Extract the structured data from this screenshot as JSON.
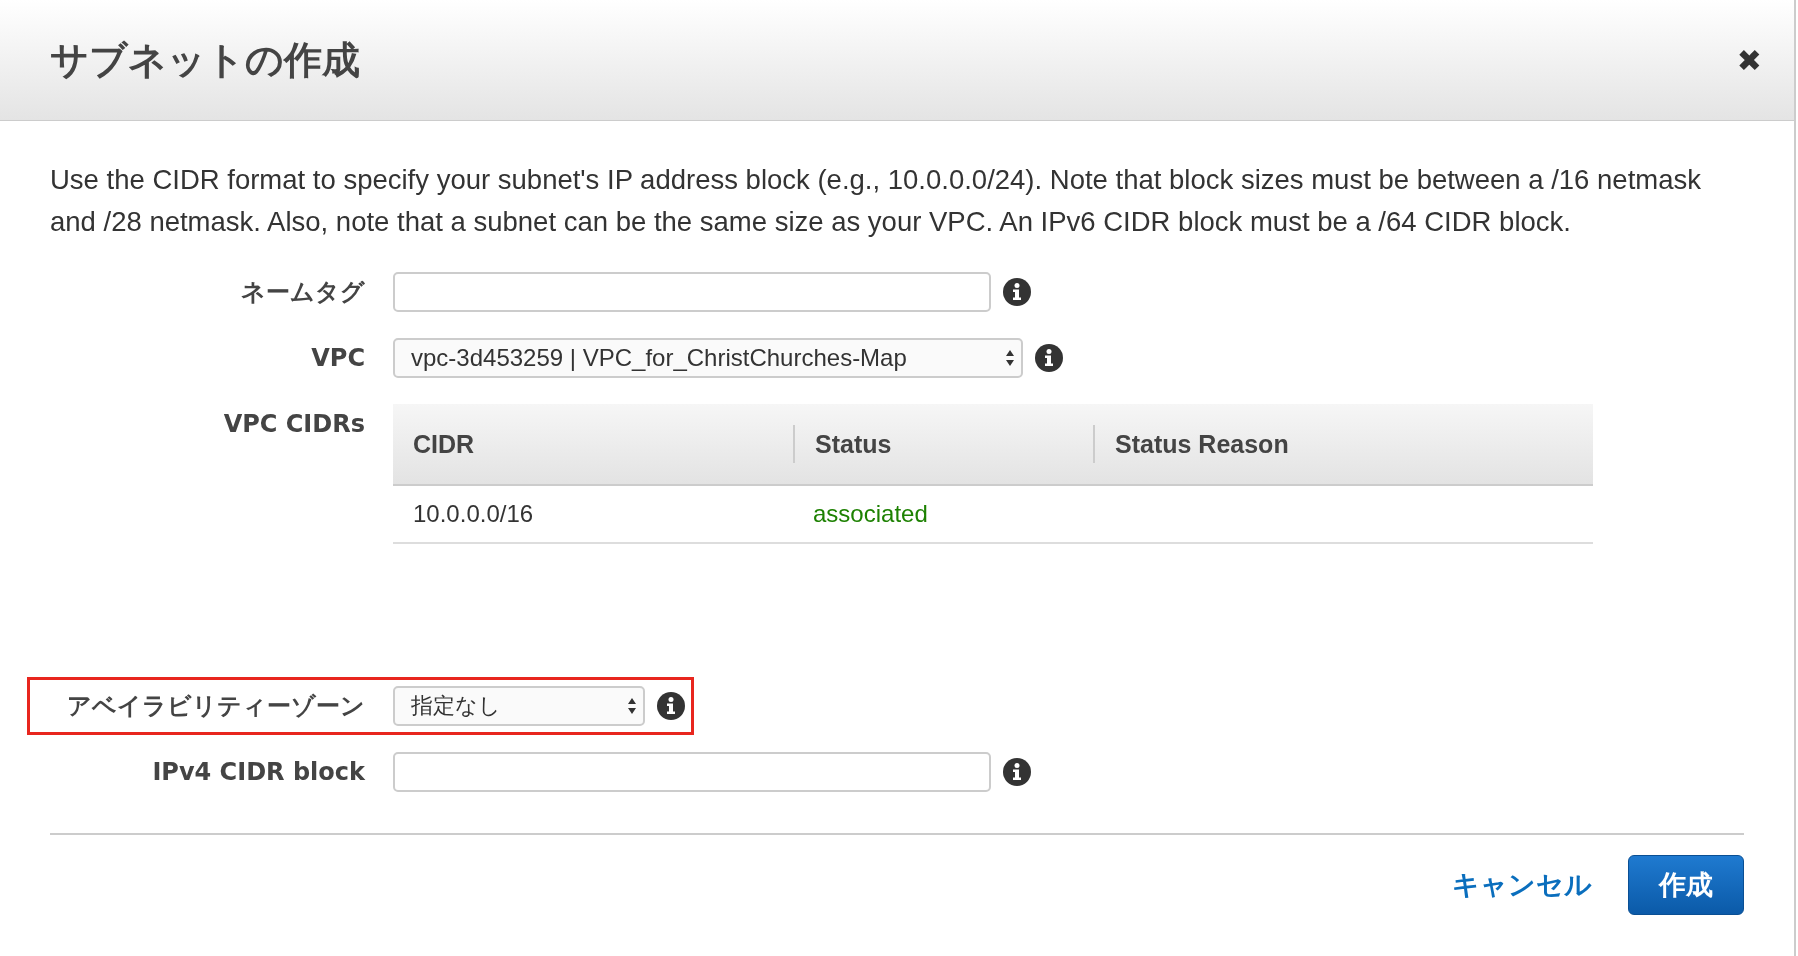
{
  "dialog": {
    "title": "サブネットの作成",
    "close_icon": "✖"
  },
  "description": "Use the CIDR format to specify your subnet's IP address block (e.g., 10.0.0.0/24). Note that block sizes must be between a /16 netmask and /28 netmask. Also, note that a subnet can be the same size as your VPC. An IPv6 CIDR block must be a /64 CIDR block.",
  "fields": [
    {
      "kind": "text",
      "label": "ネームタグ",
      "highlighted": false
    },
    {
      "kind": "select",
      "label": "VPC",
      "value": "vpc-3d453259 | VPC_for_ChristChurches-Map",
      "highlighted": false
    },
    {
      "kind": "table",
      "label": "VPC CIDRs",
      "columns": [
        "CIDR",
        "Status",
        "Status Reason"
      ],
      "rows": [
        {
          "cidr": "10.0.0.0/16",
          "status": "associated",
          "color": "#1d8102"
        }
      ]
    },
    {
      "kind": "select",
      "label": "アベイラビリティーゾーン",
      "value": "指定なし",
      "highlighted": true
    },
    {
      "kind": "text",
      "label": "IPv4 CIDR block",
      "highlighted": false
    }
  ],
  "buttons": {
    "cancel": "キャンセル",
    "create": "作成"
  }
}
